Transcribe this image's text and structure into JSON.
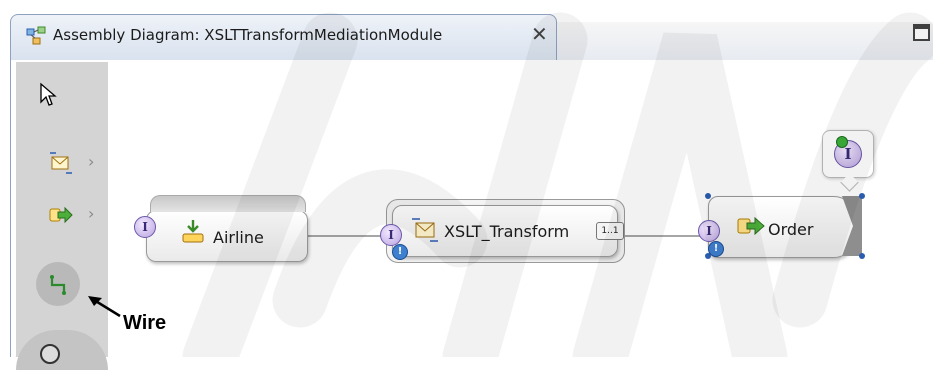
{
  "tab": {
    "title": "Assembly Diagram: XSLTTransformMediationModule",
    "close_glyph": "✕"
  },
  "palette": {
    "items": [
      {
        "icon": "selection-arrow-icon"
      },
      {
        "icon": "mediation-flow-icon"
      },
      {
        "icon": "export-import-icon"
      },
      {
        "icon": "wire-tool-icon"
      }
    ]
  },
  "nodes": {
    "airline": {
      "label": "Airline",
      "interface_glyph": "I"
    },
    "xslt": {
      "label": "XSLT_Transform",
      "interface_glyph": "I",
      "range": "1..1"
    },
    "order": {
      "label": "Order",
      "interface_glyph": "I"
    }
  },
  "callout": {
    "glyph": "I"
  },
  "annotation": {
    "wire_label": "Wire"
  },
  "colors": {
    "palette_bg": "#d4d4d4",
    "tab_border": "#8ea2c0",
    "interface_badge": "#b8a3e0",
    "selection_handle": "#2a5db0"
  }
}
